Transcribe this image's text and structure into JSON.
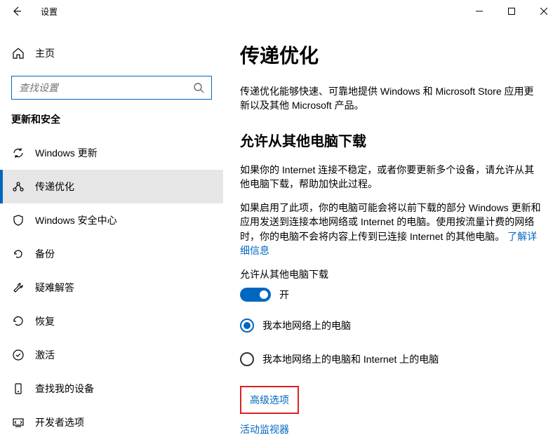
{
  "titlebar": {
    "title": "设置"
  },
  "sidebar": {
    "home": "主页",
    "search_placeholder": "查找设置",
    "section": "更新和安全",
    "items": [
      {
        "label": "Windows 更新"
      },
      {
        "label": "传递优化"
      },
      {
        "label": "Windows 安全中心"
      },
      {
        "label": "备份"
      },
      {
        "label": "疑难解答"
      },
      {
        "label": "恢复"
      },
      {
        "label": "激活"
      },
      {
        "label": "查找我的设备"
      },
      {
        "label": "开发者选项"
      }
    ]
  },
  "main": {
    "heading": "传递优化",
    "intro": "传递优化能够快速、可靠地提供 Windows 和 Microsoft Store 应用更新以及其他 Microsoft 产品。",
    "subheading": "允许从其他电脑下载",
    "para1": "如果你的 Internet 连接不稳定，或者你要更新多个设备，请允许从其他电脑下载，帮助加快此过程。",
    "para2": "如果启用了此项，你的电脑可能会将以前下载的部分 Windows 更新和应用发送到连接本地网络或 Internet 的电脑。使用按流量计费的网络时，你的电脑不会将内容上传到已连接 Internet 的其他电脑。",
    "learn_more": "了解详细信息",
    "toggle_label": "允许从其他电脑下载",
    "toggle_state": "开",
    "radio1": "我本地网络上的电脑",
    "radio2": "我本地网络上的电脑和 Internet 上的电脑",
    "advanced": "高级选项",
    "monitor": "活动监视器"
  }
}
